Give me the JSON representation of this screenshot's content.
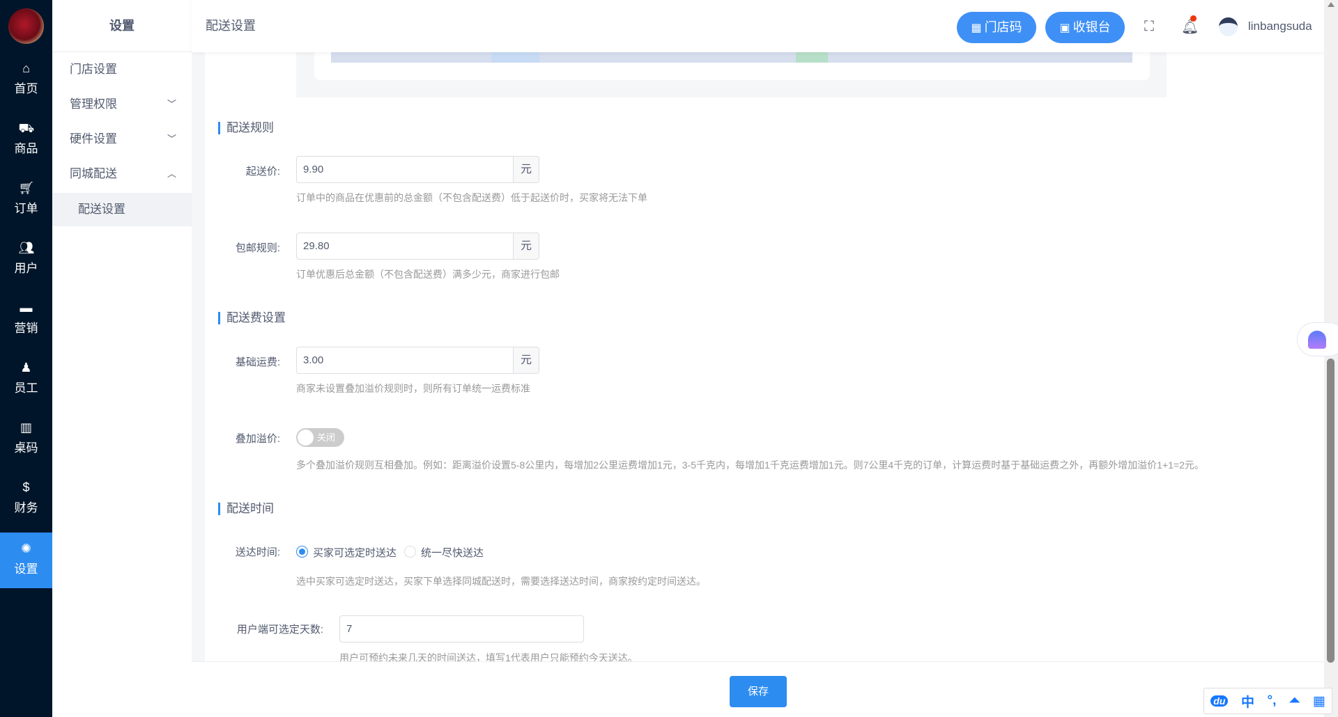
{
  "nav": {
    "items": [
      {
        "label": "首页",
        "icon": "home-icon"
      },
      {
        "label": "商品",
        "icon": "basket-icon"
      },
      {
        "label": "订单",
        "icon": "cart-icon"
      },
      {
        "label": "用户",
        "icon": "users-icon"
      },
      {
        "label": "营销",
        "icon": "marketing-icon"
      },
      {
        "label": "员工",
        "icon": "staff-icon"
      },
      {
        "label": "桌码",
        "icon": "table-code-icon"
      },
      {
        "label": "财务",
        "icon": "dollar-icon"
      },
      {
        "label": "设置",
        "icon": "gear-icon"
      }
    ]
  },
  "sub": {
    "title": "设置",
    "items": [
      {
        "label": "门店设置"
      },
      {
        "label": "管理权限"
      },
      {
        "label": "硬件设置"
      },
      {
        "label": "同城配送"
      },
      {
        "label": "配送设置"
      }
    ]
  },
  "header": {
    "title": "配送设置",
    "store_code": "门店码",
    "cashier": "收银台",
    "username": "linbangsuda"
  },
  "form": {
    "sec_rules": "配送规则",
    "sec_fee": "配送费设置",
    "sec_time": "配送时间",
    "min_label": "起送价:",
    "min_value": "9.90",
    "min_help": "订单中的商品在优惠前的总金额（不包含配送费）低于起送价时，买家将无法下单",
    "free_label": "包邮规则:",
    "free_value": "29.80",
    "free_help": "订单优惠后总金额（不包含配送费）满多少元，商家进行包邮",
    "base_label": "基础运费:",
    "base_value": "3.00",
    "base_help": "商家未设置叠加溢价规则时，则所有订单统一运费标准",
    "unit": "元",
    "premium_label": "叠加溢价:",
    "premium_toggle": "关闭",
    "premium_help": "多个叠加溢价规则互相叠加。例如：距离溢价设置5-8公里内，每增加2公里运费增加1元，3-5千克内，每增加1千克运费增加1元。则7公里4千克的订单，计算运费时基于基础运费之外，再额外增加溢价1+1=2元。",
    "time_label": "送达时间:",
    "time_opt1": "买家可选定时送达",
    "time_opt2": "统一尽快送达",
    "time_help": "选中买家可选定时送达，买家下单选择同城配送时，需要选择送达时间，商家按约定时间送达。",
    "days_label": "用户端可选定天数:",
    "days_value": "7",
    "days_help": "用户可预约未来几天的时间送达，填写1代表用户只能预约今天送达。"
  },
  "save_label": "保存",
  "ime": {
    "lang": "中",
    "punct": "°,"
  }
}
